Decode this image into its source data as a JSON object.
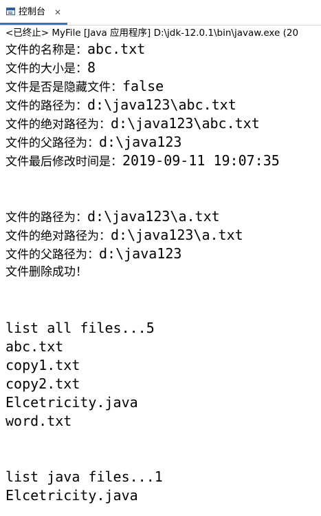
{
  "tab": {
    "label": "控制台",
    "close_glyph": "✕",
    "icon": "console-icon"
  },
  "status": {
    "text": "<已终止> MyFile [Java 应用程序] D:\\jdk-12.0.1\\bin\\javaw.exe  (20"
  },
  "console": {
    "section1": [
      {
        "label": "文件的名称是：",
        "value": "abc.txt"
      },
      {
        "label": "文件的大小是：",
        "value": "8"
      },
      {
        "label": "文件是否是隐藏文件：",
        "value": "false"
      },
      {
        "label": "文件的路径为：",
        "value": "d:\\java123\\abc.txt"
      },
      {
        "label": "文件的绝对路径为：",
        "value": "d:\\java123\\abc.txt"
      },
      {
        "label": "文件的父路径为：",
        "value": "d:\\java123"
      },
      {
        "label": "文件最后修改时间是：",
        "value": "2019-09-11 19:07:35"
      }
    ],
    "section2": [
      {
        "label": "文件的路径为：",
        "value": "d:\\java123\\a.txt"
      },
      {
        "label": "文件的绝对路径为：",
        "value": "d:\\java123\\a.txt"
      },
      {
        "label": "文件的父路径为：",
        "value": "d:\\java123"
      }
    ],
    "delete_message": "文件删除成功！",
    "list_all_header": "list all files...5",
    "all_files": [
      "abc.txt",
      "copy1.txt",
      "copy2.txt",
      "Elcetricity.java",
      "word.txt"
    ],
    "list_java_header": "list java files...1",
    "java_files": [
      "Elcetricity.java"
    ]
  }
}
